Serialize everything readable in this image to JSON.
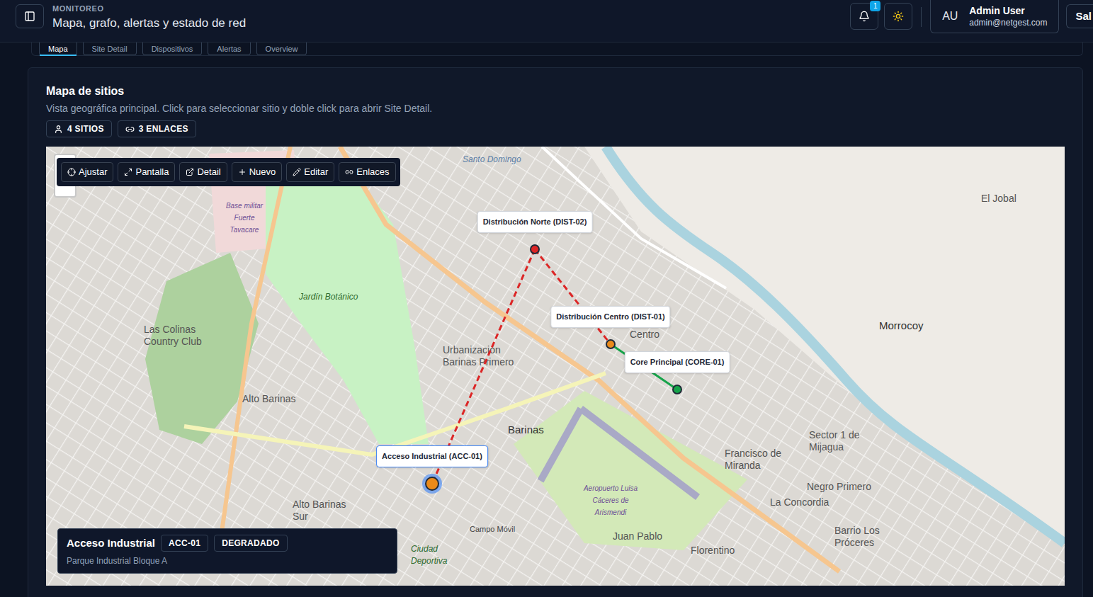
{
  "header": {
    "section": "MONITOREO",
    "title": "Mapa, grafo, alertas y estado de red",
    "notifications": "1",
    "user": {
      "initials": "AU",
      "name": "Admin User",
      "email": "admin@netgest.com"
    },
    "logout": "Sal"
  },
  "tabs": [
    {
      "label": "Mapa",
      "selected": true
    },
    {
      "label": "Site Detail",
      "selected": false
    },
    {
      "label": "Dispositivos",
      "selected": false
    },
    {
      "label": "Alertas",
      "selected": false
    },
    {
      "label": "Overview",
      "selected": false
    }
  ],
  "card": {
    "title": "Mapa de sitios",
    "subtitle": "Vista geográfica principal. Click para seleccionar sitio y doble click para abrir Site Detail.",
    "counts": [
      "4 SITIOS",
      "3 ENLACES"
    ]
  },
  "toolbar": [
    "Ajustar",
    "Pantalla",
    "Detail",
    "Nuevo",
    "Editar",
    "Enlaces"
  ],
  "sites": [
    {
      "label": "Distribución Norte (DIST-02)",
      "color": "#dc2626",
      "selected": false
    },
    {
      "label": "Distribución Centro (DIST-01)",
      "color": "#ea8a1a",
      "selected": false
    },
    {
      "label": "Core Principal (CORE-01)",
      "color": "#16a34a",
      "selected": false
    },
    {
      "label": "Acceso Industrial (ACC-01)",
      "color": "#ea8a1a",
      "selected": true
    }
  ],
  "links": [
    {
      "from": 0,
      "to": 1,
      "color": "#dc2626",
      "dashed": true
    },
    {
      "from": 1,
      "to": 2,
      "color": "#16a34a",
      "dashed": false
    },
    {
      "from": 0,
      "to": 3,
      "color": "#dc2626",
      "dashed": true
    }
  ],
  "selection": {
    "name": "Acceso Industrial",
    "code": "ACC-01",
    "status": "DEGRADADO",
    "location": "Parque Industrial Bloque A"
  },
  "map": {
    "labels": [
      {
        "text": "Santo Domingo",
        "kind": "water"
      },
      {
        "text": "El Jobal",
        "kind": "place"
      },
      {
        "text": "Morrocoy",
        "kind": "major"
      },
      {
        "text": "Jardín Botánico",
        "kind": "park"
      },
      {
        "text": "Las Colinas Country Club",
        "kind": "place"
      },
      {
        "text": "Alto Barinas",
        "kind": "place"
      },
      {
        "text": "Urbanización Barinas Primero",
        "kind": "place"
      },
      {
        "text": "Centro",
        "kind": "place"
      },
      {
        "text": "Barinas",
        "kind": "major"
      },
      {
        "text": "Francisco de Miranda",
        "kind": "place"
      },
      {
        "text": "Sector 1 de Mijagua",
        "kind": "place"
      },
      {
        "text": "Negro Primero",
        "kind": "place"
      },
      {
        "text": "La Concordia",
        "kind": "place"
      },
      {
        "text": "Barrio Los Próceres",
        "kind": "place"
      },
      {
        "text": "Juan Pablo",
        "kind": "place"
      },
      {
        "text": "Florentino",
        "kind": "place"
      },
      {
        "text": "Alto Barinas Sur",
        "kind": "place"
      },
      {
        "text": "Campo Móvil",
        "kind": "small"
      },
      {
        "text": "Aeropuerto Luisa Cáceres de Arismendi",
        "kind": "poi"
      },
      {
        "text": "Base militar Fuerte Tavacare",
        "kind": "poi"
      },
      {
        "text": "Ciudad Deportiva",
        "kind": "park"
      }
    ]
  }
}
